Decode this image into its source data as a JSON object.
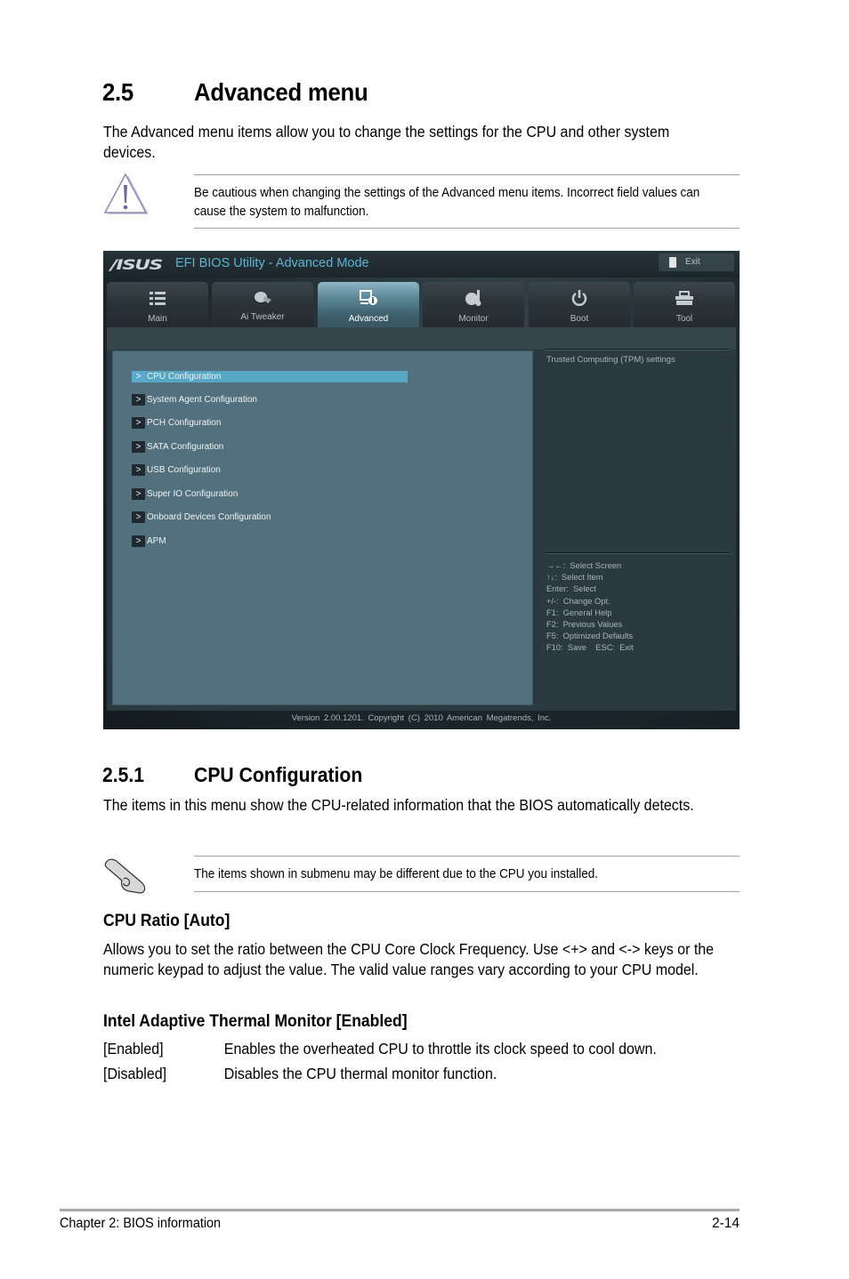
{
  "section": {
    "number": "2.5",
    "title": "Advanced menu",
    "intro": "The Advanced menu items allow you to change the settings for the CPU and other system devices."
  },
  "caution_note": {
    "icon": "warning-triangle-icon",
    "text": "Be cautious when changing the settings of the Advanced menu items. Incorrect field values can cause the system to malfunction."
  },
  "bios": {
    "logo": "/ISUS",
    "title": "EFI BIOS Utility - Advanced Mode",
    "exit_label": "Exit",
    "tabs": [
      {
        "label": "Main",
        "icon": "list-icon",
        "active": false
      },
      {
        "label": "Ai  Tweaker",
        "icon": "tweaker-icon",
        "active": false
      },
      {
        "label": "Advanced",
        "icon": "advanced-info-icon",
        "active": true
      },
      {
        "label": "Monitor",
        "icon": "thermometer-icon",
        "active": false
      },
      {
        "label": "Boot",
        "icon": "power-icon",
        "active": false
      },
      {
        "label": "Tool",
        "icon": "toolbox-icon",
        "active": false
      }
    ],
    "menu_items": [
      {
        "label": "CPU Configuration",
        "selected": true
      },
      {
        "label": "System Agent Configuration",
        "selected": false
      },
      {
        "label": "PCH Configuration",
        "selected": false
      },
      {
        "label": "SATA Configuration",
        "selected": false
      },
      {
        "label": "USB Configuration",
        "selected": false
      },
      {
        "label": "Super IO Configuration",
        "selected": false
      },
      {
        "label": "Onboard Devices Configuration",
        "selected": false
      },
      {
        "label": "APM",
        "selected": false
      }
    ],
    "arrow_glyph": ">",
    "help_description": "Trusted Computing (TPM) settings",
    "key_help": [
      "→←:  Select Screen",
      "↑↓:  Select Item",
      "Enter:  Select",
      "+/-:  Change Opt.",
      "F1:  General Help",
      "F2:  Previous Values",
      "F5:  Optimized Defaults",
      "F10:  Save    ESC:  Exit"
    ],
    "footer": "Version  2.00.1201.  Copyright  (C)  2010  American  Megatrends,  Inc."
  },
  "subsection": {
    "number": "2.5.1",
    "title": "CPU Configuration",
    "intro": "The items in this menu show the CPU-related information that the BIOS automatically detects."
  },
  "info_note": {
    "icon": "pointing-hand-icon",
    "text": "The items shown in submenu may be different due to the CPU you installed."
  },
  "cpu_ratio": {
    "heading": "CPU Ratio [Auto]",
    "body": "Allows you to set the ratio between the CPU Core Clock Frequency. Use <+> and <-> keys or the numeric keypad to adjust the value. The valid value ranges vary according to your CPU model."
  },
  "thermal_monitor": {
    "heading": "Intel Adaptive Thermal Monitor [Enabled]",
    "options": [
      {
        "key": "[Enabled]",
        "desc": "Enables the overheated CPU to throttle its clock speed to cool down."
      },
      {
        "key": "[Disabled]",
        "desc": "Disables the CPU thermal monitor function."
      }
    ]
  },
  "footer": {
    "chapter": "Chapter 2: BIOS information",
    "page": "2-14"
  }
}
